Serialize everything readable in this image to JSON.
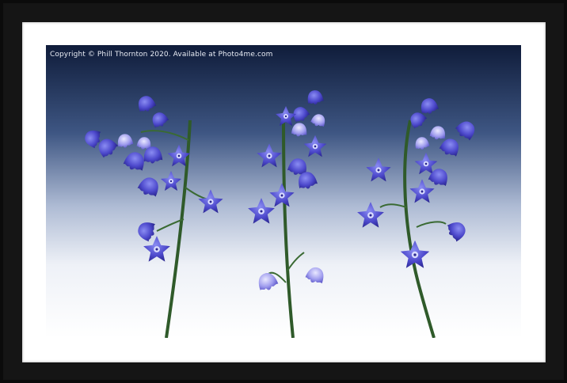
{
  "photo": {
    "caption": "Copyright  © Phill Thornton  2020. Available at Photo4me.com",
    "subject": "bluebells-artwork",
    "colors": {
      "frame": "#0b0b0b",
      "mount": "#ffffff",
      "sky_top": "#0f1c3a",
      "sky_bottom": "#ffffff",
      "flower": "#4a46c8",
      "stem": "#2f5a2a"
    }
  }
}
